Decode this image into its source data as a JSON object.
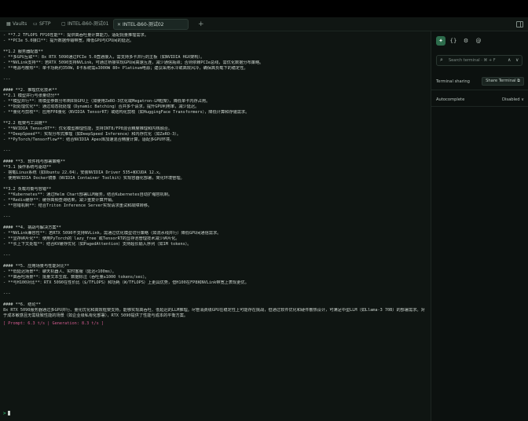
{
  "tabs": [
    {
      "label": "Vaults",
      "icon": "vault-icon"
    },
    {
      "label": "SFTP",
      "icon": "folder-icon"
    },
    {
      "label": "INTEL-B60-测试01",
      "icon": "terminal-icon"
    },
    {
      "label": "INTEL-B60-测试02",
      "icon": "close-icon"
    }
  ],
  "terminal": {
    "lines": [
      "- **7.2 TFLOPS FP16性能**：提供高吞吐量计算能力，适配批量推理需求。",
      "- **PCIe 5.0接口**：提升数据传输带宽，降低GPU与CPU间的延迟。",
      "",
      "**1.2 服务器配置**",
      "- **多GPU互联**：8x RTX 5090通过PCIe 5.0直通接入，需支持多卡并行的主板（如NVIDIA HGX架构）。",
      "- **NVLink支持**：若RTX 5090支持NVLink，可通过桥接实现GPU间高速互连，减少通信瓶颈；否则依赖PCIe总线，需优化数据分布策略。",
      "- **电源与散热**：单卡功耗约350W，8卡系统需≥3000W 80+ Platinum电源；建议采用水冷或高效风冷，确保高负载下的稳定性。",
      "",
      "---",
      "",
      "#### **2. 推理优化技术**",
      "**2.1 模型并行与张量切分**",
      "- **模型并行**：将模型参数分布到8块GPU上（如使用ZeRO-3优化或Megatron-LM框架），降低单卡内存占用。",
      "- **批处理优化**：通过动态批处理（Dynamic Batching）合并多个请求，提升GPU利用率，减少延迟。",
      "- **量化与剪枝**：应用FP8量化（NVIDIA TensorRT）或结构化剪枝（如HuggingFace Transformers），降低计算和存储需求。",
      "",
      "**2.2 框架与工具链**",
      "- **NVIDIA TensorRT**：优化模型推理性能，支持INT8/FP8混合精度推理和内核融合。",
      "- **DeepSpeed**：实现分布式推理（如DeepSpeed Inference）和内存优化（如ZeRO-3）。",
      "- **PyTorch/TensorFlow**：结合NVIDIA Apex库加速混合精度计算，适配多GPU环境。",
      "",
      "---",
      "",
      "#### **3. 软件栈与部署策略**",
      "**3.1 操作系统与驱动**",
      "- 搭载Linux系统（如Ubuntu 22.04），安装NVIDIA Driver 535+和CUDA 12.x。",
      "- 使用NVIDIA Docker镜像（NVIDIA Container Toolkit）实现容器化部署，简化环境管理。",
      "",
      "**3.2 负载均衡与容错**",
      "- **Kubernetes**：通过Helm Chart部署LLM服务，结合Kubernetes自动扩缩容机制。",
      "- **Redis缓存**：缓存高频查询结果，减少重复计算开销。",
      "- **容错机制**：结合Triton Inference Server实现请求重试和故障转移。",
      "",
      "---",
      "",
      "#### **4. 挑战与解决方案**",
      "- **NVLink兼容性**：若RTX 5090不支持NVLink，需通过优化模型切分策略（如流水线并行）降低GPU间通信需求。",
      "- **显存碎片化**：使用PyTorch的`lazy_free`或TensorRT的显存池管理技术减少碎片化。",
      "- **长上下文处理**：结合KV缓存优化（如PagedAttention）支持超长输入序列（如1M tokens）。",
      "",
      "---",
      "",
      "#### **5. 应用场景与性能对比**",
      "- **低延迟场景**：聊天机器人、实时客服（延迟<100ms）。",
      "- **高吞吐场景**：批量文本生成、数据标注（吞吐量≥1000 tokens/sec）。",
      "- **与H100对比**：RTX 5090在性价比（$/TFLOPS）和功耗（W/TFLOPS）上更具优势，但H100在FP8和NVLink带宽上表现更优。",
      "",
      "---",
      "",
      "#### **6. 结论**"
    ],
    "conclusion": "8x RTX 5090服务器通过多GPU并行、量化优化和高效框架支持，能够实现高吞吐、低延迟的LLM推理。尽管消费级GPU在稳定性上可能存在挑战，但通过软件优化和硬件散热设计，可满足中型LLM（如Llama-3 70B）的部署需求。对于成本敏感且无需极致性能的场景（如企业级私有化部署），RTX 5090提供了性能与成本的平衡方案。",
    "stats": "[ Prompt: 6.3 t/s | Generation: 8.3 t/s ]",
    "prompt_symbol": ">"
  },
  "sidebar": {
    "icons": [
      "ai-assistant-icon",
      "code-braces-icon",
      "gear-icon",
      "at-sign-icon"
    ],
    "search_placeholder": "Search terminal · ⌘ + F",
    "terminal_sharing_label": "Terminal sharing",
    "share_button_label": "Share Terminal",
    "autocomplete_label": "Autocomplete",
    "autocomplete_value": "Disabled"
  }
}
